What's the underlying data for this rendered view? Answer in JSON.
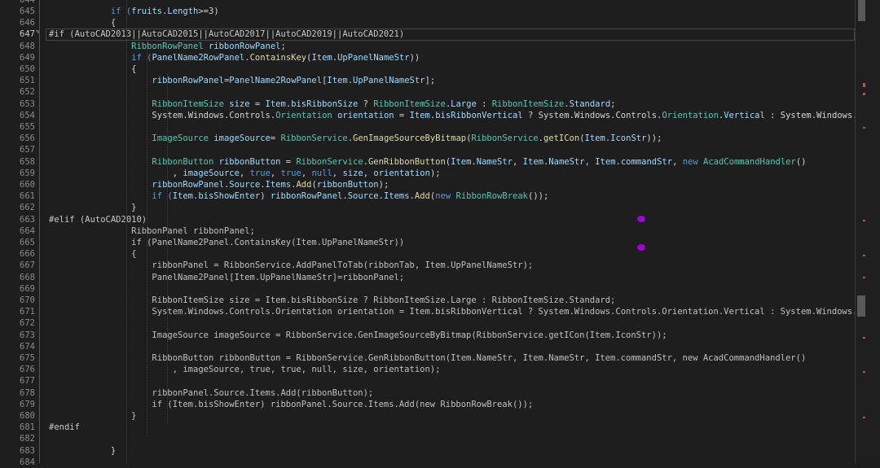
{
  "editor": {
    "lines": [
      {
        "num": "644",
        "segments": []
      },
      {
        "num": "645",
        "segments": [
          {
            "t": "            if (",
            "c": "t-kw"
          },
          {
            "t": "fruits",
            "c": "t-var"
          },
          {
            "t": ".",
            "c": "t-plain"
          },
          {
            "t": "Length",
            "c": "t-var"
          },
          {
            "t": ">=3)",
            "c": "t-plain"
          }
        ]
      },
      {
        "num": "646",
        "segments": [
          {
            "t": "            {",
            "c": "t-plain"
          }
        ]
      },
      {
        "num": "647",
        "segments": [
          {
            "t": "#if (AutoCAD2013||AutoCAD2015||AutoCAD2017||AutoCAD2019||AutoCAD2021)",
            "c": "t-pp"
          }
        ],
        "active": true
      },
      {
        "num": "648",
        "segments": [
          {
            "t": "                RibbonRowPanel ",
            "c": "t-type"
          },
          {
            "t": "ribbonRowPanel",
            "c": "t-var"
          },
          {
            "t": ";",
            "c": "t-plain"
          }
        ]
      },
      {
        "num": "649",
        "segments": [
          {
            "t": "                if (",
            "c": "t-kw"
          },
          {
            "t": "PanelName2RowPanel",
            "c": "t-var"
          },
          {
            "t": ".",
            "c": "t-plain"
          },
          {
            "t": "ContainsKey",
            "c": "t-fn"
          },
          {
            "t": "(",
            "c": "t-plain"
          },
          {
            "t": "Item",
            "c": "t-var"
          },
          {
            "t": ".",
            "c": "t-plain"
          },
          {
            "t": "UpPanelNameStr",
            "c": "t-var"
          },
          {
            "t": "))",
            "c": "t-plain"
          }
        ]
      },
      {
        "num": "650",
        "segments": [
          {
            "t": "                {",
            "c": "t-plain"
          }
        ]
      },
      {
        "num": "651",
        "segments": [
          {
            "t": "                    ribbonRowPanel",
            "c": "t-var"
          },
          {
            "t": "=",
            "c": "t-plain"
          },
          {
            "t": "PanelName2RowPanel",
            "c": "t-var"
          },
          {
            "t": "[",
            "c": "t-plain"
          },
          {
            "t": "Item",
            "c": "t-var"
          },
          {
            "t": ".",
            "c": "t-plain"
          },
          {
            "t": "UpPanelNameStr",
            "c": "t-var"
          },
          {
            "t": "];",
            "c": "t-plain"
          }
        ]
      },
      {
        "num": "652",
        "segments": []
      },
      {
        "num": "653",
        "segments": [
          {
            "t": "                    RibbonItemSize ",
            "c": "t-type"
          },
          {
            "t": "size",
            "c": "t-var"
          },
          {
            "t": " = ",
            "c": "t-plain"
          },
          {
            "t": "Item",
            "c": "t-var"
          },
          {
            "t": ".",
            "c": "t-plain"
          },
          {
            "t": "bisRibbonSize",
            "c": "t-var"
          },
          {
            "t": " ? ",
            "c": "t-plain"
          },
          {
            "t": "RibbonItemSize",
            "c": "t-type"
          },
          {
            "t": ".",
            "c": "t-plain"
          },
          {
            "t": "Large",
            "c": "t-var"
          },
          {
            "t": " : ",
            "c": "t-plain"
          },
          {
            "t": "RibbonItemSize",
            "c": "t-type"
          },
          {
            "t": ".",
            "c": "t-plain"
          },
          {
            "t": "Standard",
            "c": "t-var"
          },
          {
            "t": ";",
            "c": "t-plain"
          }
        ]
      },
      {
        "num": "654",
        "segments": [
          {
            "t": "                    System",
            "c": "t-plain"
          },
          {
            "t": ".",
            "c": "t-plain"
          },
          {
            "t": "Windows",
            "c": "t-plain"
          },
          {
            "t": ".",
            "c": "t-plain"
          },
          {
            "t": "Controls",
            "c": "t-plain"
          },
          {
            "t": ".",
            "c": "t-plain"
          },
          {
            "t": "Orientation ",
            "c": "t-type"
          },
          {
            "t": "orientation",
            "c": "t-var"
          },
          {
            "t": " = ",
            "c": "t-plain"
          },
          {
            "t": "Item",
            "c": "t-var"
          },
          {
            "t": ".",
            "c": "t-plain"
          },
          {
            "t": "bisRibbonVertical",
            "c": "t-var"
          },
          {
            "t": " ? ",
            "c": "t-plain"
          },
          {
            "t": "System.Windows.Controls.",
            "c": "t-plain"
          },
          {
            "t": "Orientation",
            "c": "t-type"
          },
          {
            "t": ".",
            "c": "t-plain"
          },
          {
            "t": "Vertical",
            "c": "t-var"
          },
          {
            "t": " : System.Windows.",
            "c": "t-plain"
          }
        ]
      },
      {
        "num": "655",
        "segments": []
      },
      {
        "num": "656",
        "segments": [
          {
            "t": "                    ImageSource ",
            "c": "t-type"
          },
          {
            "t": "imageSource",
            "c": "t-var"
          },
          {
            "t": "= ",
            "c": "t-plain"
          },
          {
            "t": "RibbonService",
            "c": "t-type"
          },
          {
            "t": ".",
            "c": "t-plain"
          },
          {
            "t": "GenImageSourceByBitmap",
            "c": "t-fn"
          },
          {
            "t": "(",
            "c": "t-plain"
          },
          {
            "t": "RibbonService",
            "c": "t-type"
          },
          {
            "t": ".",
            "c": "t-plain"
          },
          {
            "t": "getICon",
            "c": "t-fn"
          },
          {
            "t": "(",
            "c": "t-plain"
          },
          {
            "t": "Item",
            "c": "t-var"
          },
          {
            "t": ".",
            "c": "t-plain"
          },
          {
            "t": "IconStr",
            "c": "t-var"
          },
          {
            "t": "));",
            "c": "t-plain"
          }
        ]
      },
      {
        "num": "657",
        "segments": []
      },
      {
        "num": "658",
        "segments": [
          {
            "t": "                    RibbonButton ",
            "c": "t-type"
          },
          {
            "t": "ribbonButton",
            "c": "t-var"
          },
          {
            "t": " = ",
            "c": "t-plain"
          },
          {
            "t": "RibbonService",
            "c": "t-type"
          },
          {
            "t": ".",
            "c": "t-plain"
          },
          {
            "t": "GenRibbonButton",
            "c": "t-fn"
          },
          {
            "t": "(",
            "c": "t-plain"
          },
          {
            "t": "Item",
            "c": "t-var"
          },
          {
            "t": ".",
            "c": "t-plain"
          },
          {
            "t": "NameStr",
            "c": "t-var"
          },
          {
            "t": ", ",
            "c": "t-plain"
          },
          {
            "t": "Item",
            "c": "t-var"
          },
          {
            "t": ".",
            "c": "t-plain"
          },
          {
            "t": "NameStr",
            "c": "t-var"
          },
          {
            "t": ", ",
            "c": "t-plain"
          },
          {
            "t": "Item",
            "c": "t-var"
          },
          {
            "t": ".",
            "c": "t-plain"
          },
          {
            "t": "commandStr",
            "c": "t-var"
          },
          {
            "t": ", ",
            "c": "t-plain"
          },
          {
            "t": "new ",
            "c": "t-kw"
          },
          {
            "t": "AcadCommandHandler",
            "c": "t-type"
          },
          {
            "t": "()",
            "c": "t-plain"
          }
        ]
      },
      {
        "num": "659",
        "segments": [
          {
            "t": "                        , ",
            "c": "t-plain"
          },
          {
            "t": "imageSource",
            "c": "t-var"
          },
          {
            "t": ", ",
            "c": "t-plain"
          },
          {
            "t": "true",
            "c": "t-kw"
          },
          {
            "t": ", ",
            "c": "t-plain"
          },
          {
            "t": "true",
            "c": "t-kw"
          },
          {
            "t": ", ",
            "c": "t-plain"
          },
          {
            "t": "null",
            "c": "t-kw"
          },
          {
            "t": ", ",
            "c": "t-plain"
          },
          {
            "t": "size",
            "c": "t-var"
          },
          {
            "t": ", ",
            "c": "t-plain"
          },
          {
            "t": "orientation",
            "c": "t-var"
          },
          {
            "t": ");",
            "c": "t-plain"
          }
        ]
      },
      {
        "num": "660",
        "segments": [
          {
            "t": "                    ribbonRowPanel",
            "c": "t-var"
          },
          {
            "t": ".",
            "c": "t-plain"
          },
          {
            "t": "Source",
            "c": "t-var"
          },
          {
            "t": ".",
            "c": "t-plain"
          },
          {
            "t": "Items",
            "c": "t-var"
          },
          {
            "t": ".",
            "c": "t-plain"
          },
          {
            "t": "Add",
            "c": "t-fn"
          },
          {
            "t": "(",
            "c": "t-plain"
          },
          {
            "t": "ribbonButton",
            "c": "t-var"
          },
          {
            "t": ");",
            "c": "t-plain"
          }
        ]
      },
      {
        "num": "661",
        "segments": [
          {
            "t": "                    if (",
            "c": "t-kw"
          },
          {
            "t": "Item",
            "c": "t-var"
          },
          {
            "t": ".",
            "c": "t-plain"
          },
          {
            "t": "bisShowEnter",
            "c": "t-var"
          },
          {
            "t": ") ",
            "c": "t-plain"
          },
          {
            "t": "ribbonRowPanel",
            "c": "t-var"
          },
          {
            "t": ".",
            "c": "t-plain"
          },
          {
            "t": "Source",
            "c": "t-var"
          },
          {
            "t": ".",
            "c": "t-plain"
          },
          {
            "t": "Items",
            "c": "t-var"
          },
          {
            "t": ".",
            "c": "t-plain"
          },
          {
            "t": "Add",
            "c": "t-fn"
          },
          {
            "t": "(",
            "c": "t-plain"
          },
          {
            "t": "new ",
            "c": "t-kw"
          },
          {
            "t": "RibbonRowBreak",
            "c": "t-type"
          },
          {
            "t": "());",
            "c": "t-plain"
          }
        ]
      },
      {
        "num": "662",
        "segments": [
          {
            "t": "                }",
            "c": "t-plain"
          }
        ]
      },
      {
        "num": "663",
        "segments": [
          {
            "t": "#elif (AutoCAD2010)",
            "c": "t-pp"
          }
        ]
      },
      {
        "num": "664",
        "segments": [
          {
            "t": "                RibbonPanel ribbonPanel;",
            "c": "t-dim"
          }
        ]
      },
      {
        "num": "665",
        "segments": [
          {
            "t": "                if (PanelName2Panel.ContainsKey(Item.UpPanelNameStr))",
            "c": "t-dim"
          }
        ]
      },
      {
        "num": "666",
        "segments": [
          {
            "t": "                {",
            "c": "t-dim"
          }
        ]
      },
      {
        "num": "667",
        "segments": [
          {
            "t": "                    ribbonPanel = RibbonService.AddPanelToTab(ribbonTab, Item.UpPanelNameStr);",
            "c": "t-dim"
          }
        ]
      },
      {
        "num": "668",
        "segments": [
          {
            "t": "                    PanelName2Panel[Item.UpPanelNameStr]=ribbonPanel;",
            "c": "t-dim"
          }
        ]
      },
      {
        "num": "669",
        "segments": []
      },
      {
        "num": "670",
        "segments": [
          {
            "t": "                    RibbonItemSize size = Item.bisRibbonSize ? RibbonItemSize.Large : RibbonItemSize.Standard;",
            "c": "t-dim"
          }
        ]
      },
      {
        "num": "671",
        "segments": [
          {
            "t": "                    System.Windows.Controls.Orientation orientation = Item.bisRibbonVertical ? System.Windows.Controls.Orientation.Vertical : System.Windows.",
            "c": "t-dim"
          }
        ]
      },
      {
        "num": "672",
        "segments": []
      },
      {
        "num": "673",
        "segments": [
          {
            "t": "                    ImageSource imageSource = RibbonService.GenImageSourceByBitmap(RibbonService.getICon(Item.IconStr));",
            "c": "t-dim"
          }
        ]
      },
      {
        "num": "674",
        "segments": []
      },
      {
        "num": "675",
        "segments": [
          {
            "t": "                    RibbonButton ribbonButton = RibbonService.GenRibbonButton(Item.NameStr, Item.NameStr, Item.commandStr, new AcadCommandHandler()",
            "c": "t-dim"
          }
        ]
      },
      {
        "num": "676",
        "segments": [
          {
            "t": "                        , imageSource, true, true, null, size, orientation);",
            "c": "t-dim"
          }
        ]
      },
      {
        "num": "677",
        "segments": []
      },
      {
        "num": "678",
        "segments": [
          {
            "t": "                    ribbonPanel.Source.Items.Add(ribbonButton);",
            "c": "t-dim"
          }
        ]
      },
      {
        "num": "679",
        "segments": [
          {
            "t": "                    if (Item.bisShowEnter) ribbonPanel.Source.Items.Add(new RibbonRowBreak());",
            "c": "t-dim"
          }
        ]
      },
      {
        "num": "680",
        "segments": [
          {
            "t": "                }",
            "c": "t-dim"
          }
        ]
      },
      {
        "num": "681",
        "segments": [
          {
            "t": "#endif",
            "c": "t-pp"
          }
        ]
      },
      {
        "num": "682",
        "segments": []
      },
      {
        "num": "683",
        "segments": [
          {
            "t": "            }",
            "c": "t-plain"
          }
        ]
      },
      {
        "num": "684",
        "segments": []
      }
    ]
  },
  "colors": {
    "background": "#1e1e1e",
    "keyword": "#569cd6",
    "type": "#4ec9b0",
    "variable": "#9cdcfe",
    "inactive_code": "#c0c0c0",
    "change_marker": "#c0504d",
    "breakpoint_marker": "#a100d8"
  }
}
